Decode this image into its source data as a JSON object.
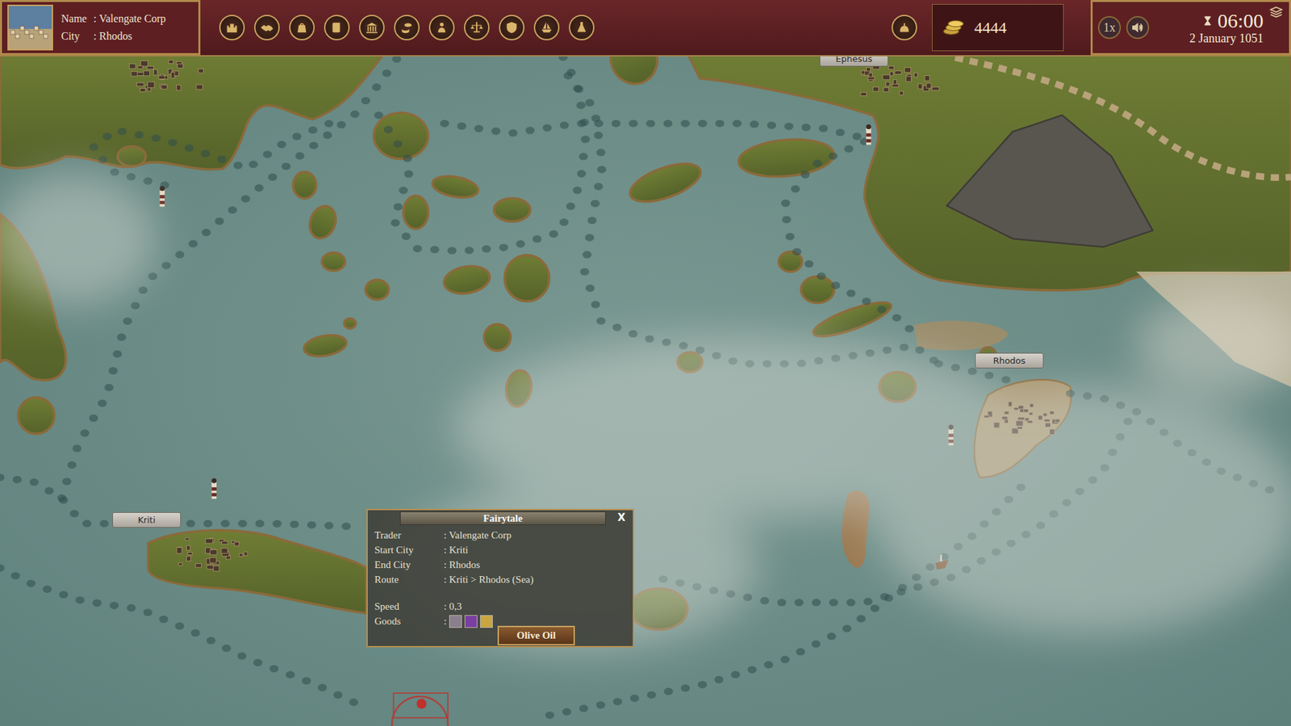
{
  "profile": {
    "separator": ":",
    "rows": [
      {
        "label": "Name",
        "value": "Valengate Corp"
      },
      {
        "label": "City",
        "value": "Rhodos"
      }
    ]
  },
  "gold": "4444",
  "speed_button": "1x",
  "clock": {
    "time": "06:00",
    "date": "2 January 1051"
  },
  "cities": [
    {
      "name": "Ephesus"
    },
    {
      "name": "Kriti"
    },
    {
      "name": "Rhodos"
    }
  ],
  "ship_popup": {
    "title": "Fairytale",
    "close": "X",
    "separator": ":",
    "fields": [
      {
        "label": "Trader",
        "value": "Valengate Corp"
      },
      {
        "label": "Start City",
        "value": "Kriti"
      },
      {
        "label": "End City",
        "value": "Rhodos"
      },
      {
        "label": "Route",
        "value": "Kriti > Rhodos (Sea)"
      },
      {
        "label": "Speed",
        "value": "0,3"
      }
    ],
    "goods_label": "Goods",
    "goods": [
      {
        "color": "#8a7f8c"
      },
      {
        "color": "#7a3fa0"
      },
      {
        "color": "#c9a640"
      }
    ],
    "tooltip": "Olive Oil"
  }
}
